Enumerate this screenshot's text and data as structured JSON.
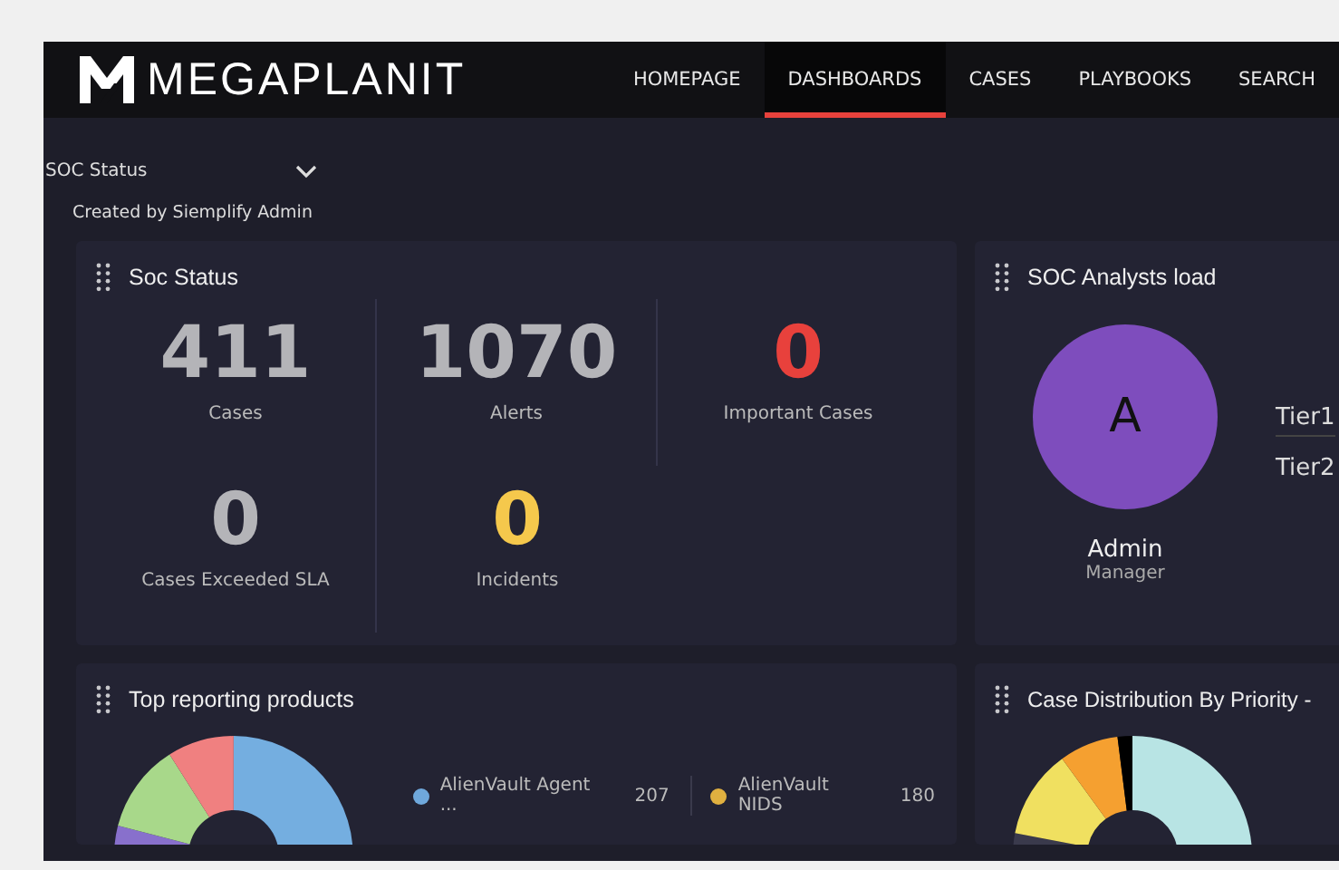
{
  "brand": "MEGAPLANIT",
  "nav": [
    {
      "label": "HOMEPAGE",
      "selected": false
    },
    {
      "label": "DASHBOARDS",
      "selected": true
    },
    {
      "label": "CASES",
      "selected": false
    },
    {
      "label": "PLAYBOOKS",
      "selected": false
    },
    {
      "label": "SEARCH",
      "selected": false
    }
  ],
  "dashboard_select": {
    "value": "SOC Status"
  },
  "created_by": "Created by Siemplify Admin",
  "soc_status": {
    "title": "Soc Status",
    "stats": [
      {
        "value": "411",
        "label": "Cases",
        "color": "#b4b4b8"
      },
      {
        "value": "1070",
        "label": "Alerts",
        "color": "#b4b4b8"
      },
      {
        "value": "0",
        "label": "Important Cases",
        "color": "#e8413c"
      },
      {
        "value": "0",
        "label": "Cases Exceeded SLA",
        "color": "#b4b4b8"
      },
      {
        "value": "0",
        "label": "Incidents",
        "color": "#f5c84c"
      }
    ]
  },
  "analysts": {
    "title": "SOC Analysts load",
    "avatar_letter": "A",
    "name": "Admin",
    "role": "Manager",
    "tiers": [
      "Tier1",
      "Tier2"
    ]
  },
  "top_products": {
    "title": "Top reporting products",
    "legend": [
      {
        "name": "AlienVault Agent ...",
        "count": "207",
        "color": "#6fa8dc"
      },
      {
        "name": "AlienVault NIDS",
        "count": "180",
        "color": "#e0b040"
      }
    ]
  },
  "case_distribution": {
    "title": "Case Distribution By Priority -"
  }
}
